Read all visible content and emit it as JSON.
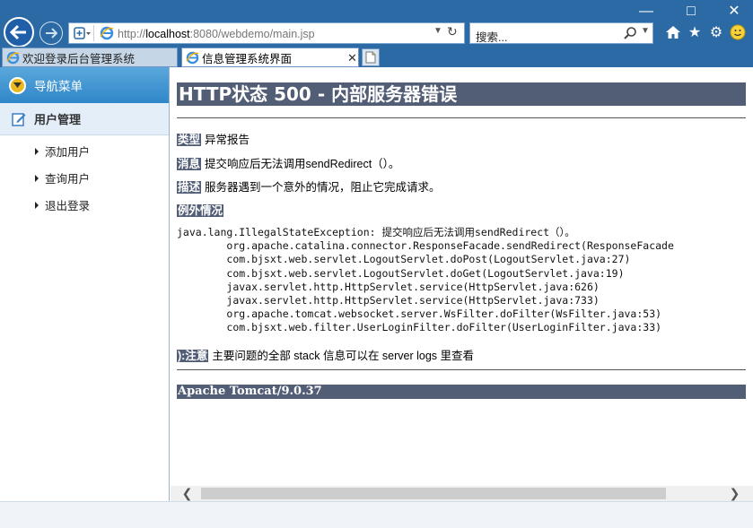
{
  "browser": {
    "url_prefix": "http://",
    "url_host": "localhost",
    "url_rest": ":8080/webdemo/main.jsp",
    "search_placeholder": "搜索...",
    "tabs": [
      {
        "label": "欢迎登录后台管理系统",
        "active": false
      },
      {
        "label": "信息管理系统界面",
        "active": true
      }
    ]
  },
  "sidebar": {
    "header": "导航菜单",
    "group": "用户管理",
    "items": [
      {
        "label": "添加用户"
      },
      {
        "label": "查询用户"
      },
      {
        "label": "退出登录"
      }
    ]
  },
  "error_page": {
    "title": "HTTP状态 500 - 内部服务器错误",
    "type_label": "类型",
    "type_text": "异常报告",
    "message_label": "消息",
    "message_text": "提交响应后无法调用sendRedirect（）。",
    "desc_label": "描述",
    "desc_text": "服务器遇到一个意外的情况，阻止它完成请求。",
    "exception_label": "例外情况",
    "stack_trace": "java.lang.IllegalStateException: 提交响应后无法调用sendRedirect（）。\n\torg.apache.catalina.connector.ResponseFacade.sendRedirect(ResponseFacade\n\tcom.bjsxt.web.servlet.LogoutServlet.doPost(LogoutServlet.java:27)\n\tcom.bjsxt.web.servlet.LogoutServlet.doGet(LogoutServlet.java:19)\n\tjavax.servlet.http.HttpServlet.service(HttpServlet.java:626)\n\tjavax.servlet.http.HttpServlet.service(HttpServlet.java:733)\n\torg.apache.tomcat.websocket.server.WsFilter.doFilter(WsFilter.java:53)\n\tcom.bjsxt.web.filter.UserLoginFilter.doFilter(UserLoginFilter.java:33)",
    "note_label": "):注意",
    "note_text": "主要问题的全部 stack 信息可以在 server logs 里查看",
    "footer": "Apache Tomcat/9.0.37"
  },
  "colors": {
    "chrome": "#2b6aa5",
    "tomcat_header": "#525d76",
    "sidebar_header": "#2f86c8"
  }
}
